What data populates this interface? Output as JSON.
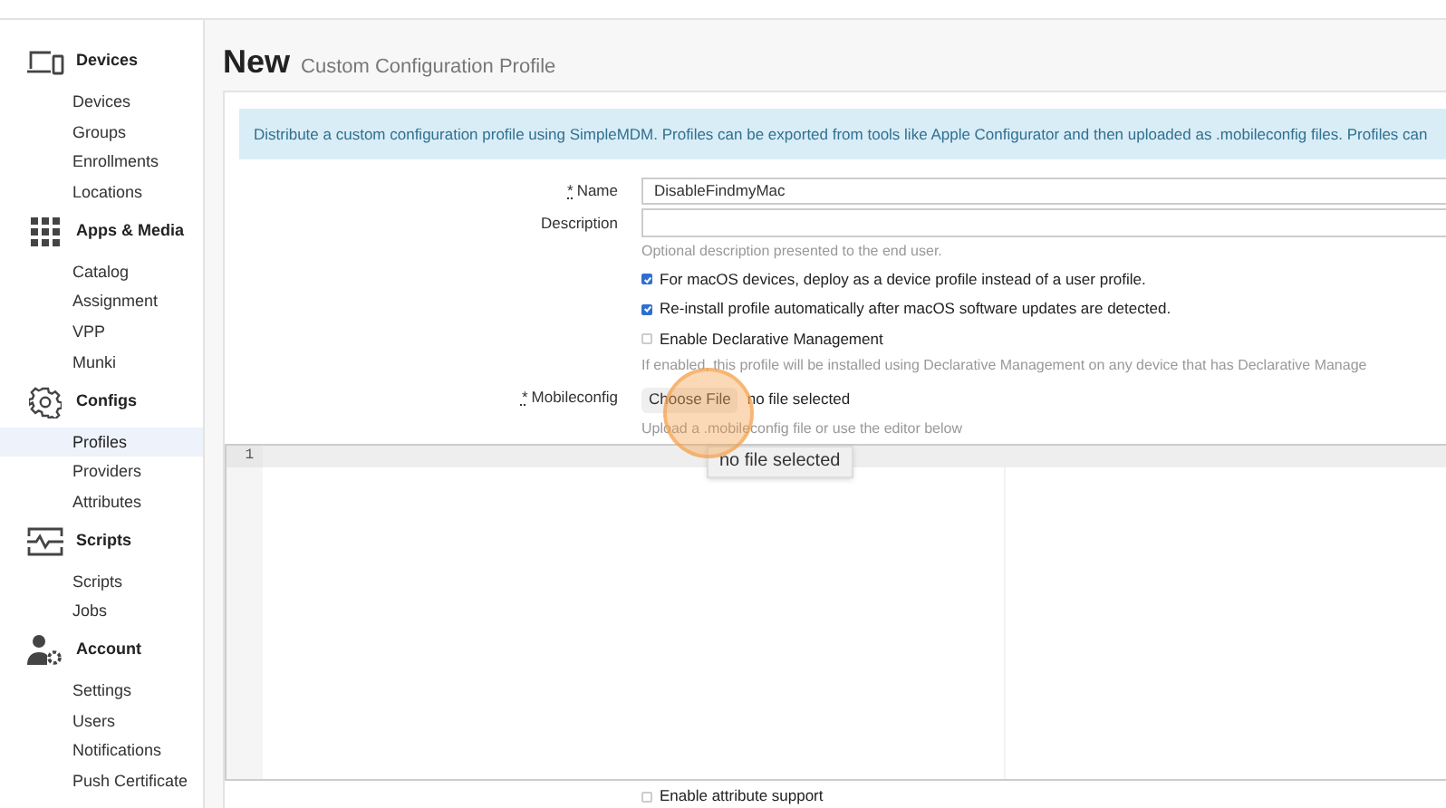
{
  "sidebar": {
    "sections": [
      {
        "title": "Devices",
        "items": [
          {
            "label": "Devices",
            "selected": false
          },
          {
            "label": "Groups",
            "selected": false
          },
          {
            "label": "Enrollments",
            "selected": false
          },
          {
            "label": "Locations",
            "selected": false
          }
        ]
      },
      {
        "title": "Apps & Media",
        "items": [
          {
            "label": "Catalog",
            "selected": false
          },
          {
            "label": "Assignment",
            "selected": false
          },
          {
            "label": "VPP",
            "selected": false
          },
          {
            "label": "Munki",
            "selected": false
          }
        ]
      },
      {
        "title": "Configs",
        "items": [
          {
            "label": "Profiles",
            "selected": true
          },
          {
            "label": "Providers",
            "selected": false
          },
          {
            "label": "Attributes",
            "selected": false
          }
        ]
      },
      {
        "title": "Scripts",
        "items": [
          {
            "label": "Scripts",
            "selected": false
          },
          {
            "label": "Jobs",
            "selected": false
          }
        ]
      },
      {
        "title": "Account",
        "items": [
          {
            "label": "Settings",
            "selected": false
          },
          {
            "label": "Users",
            "selected": false
          },
          {
            "label": "Notifications",
            "selected": false
          },
          {
            "label": "Push Certificate",
            "selected": false
          }
        ]
      }
    ]
  },
  "page": {
    "title": "New",
    "subtitle": "Custom Configuration Profile"
  },
  "alert": "Distribute a custom configuration profile using SimpleMDM. Profiles can be exported from tools like Apple Configurator and then uploaded as .mobileconfig files. Profiles can",
  "form": {
    "name": {
      "required_mark": "*",
      "label": "Name",
      "value": "DisableFindmyMac"
    },
    "description": {
      "label": "Description",
      "hint": "Optional description presented to the end user."
    },
    "options": [
      {
        "label": "For macOS devices, deploy as a device profile instead of a user profile.",
        "checked": true
      },
      {
        "label": "Re-install profile automatically after macOS software updates are detected.",
        "checked": true
      },
      {
        "label": "Enable Declarative Management",
        "checked": false
      }
    ],
    "declarative_hint": "If enabled, this profile will be installed using Declarative Management on any device that has Declarative Manage",
    "mobileconfig": {
      "required_mark": "*",
      "label": "Mobileconfig",
      "button": "Choose File",
      "file_status": "no file selected",
      "hint": "Upload a .mobileconfig file or use the editor below",
      "tooltip": "no file selected"
    },
    "editor": {
      "line_numbers": [
        "1"
      ]
    },
    "attribute_support": {
      "label": "Enable attribute support",
      "checked": false
    }
  }
}
